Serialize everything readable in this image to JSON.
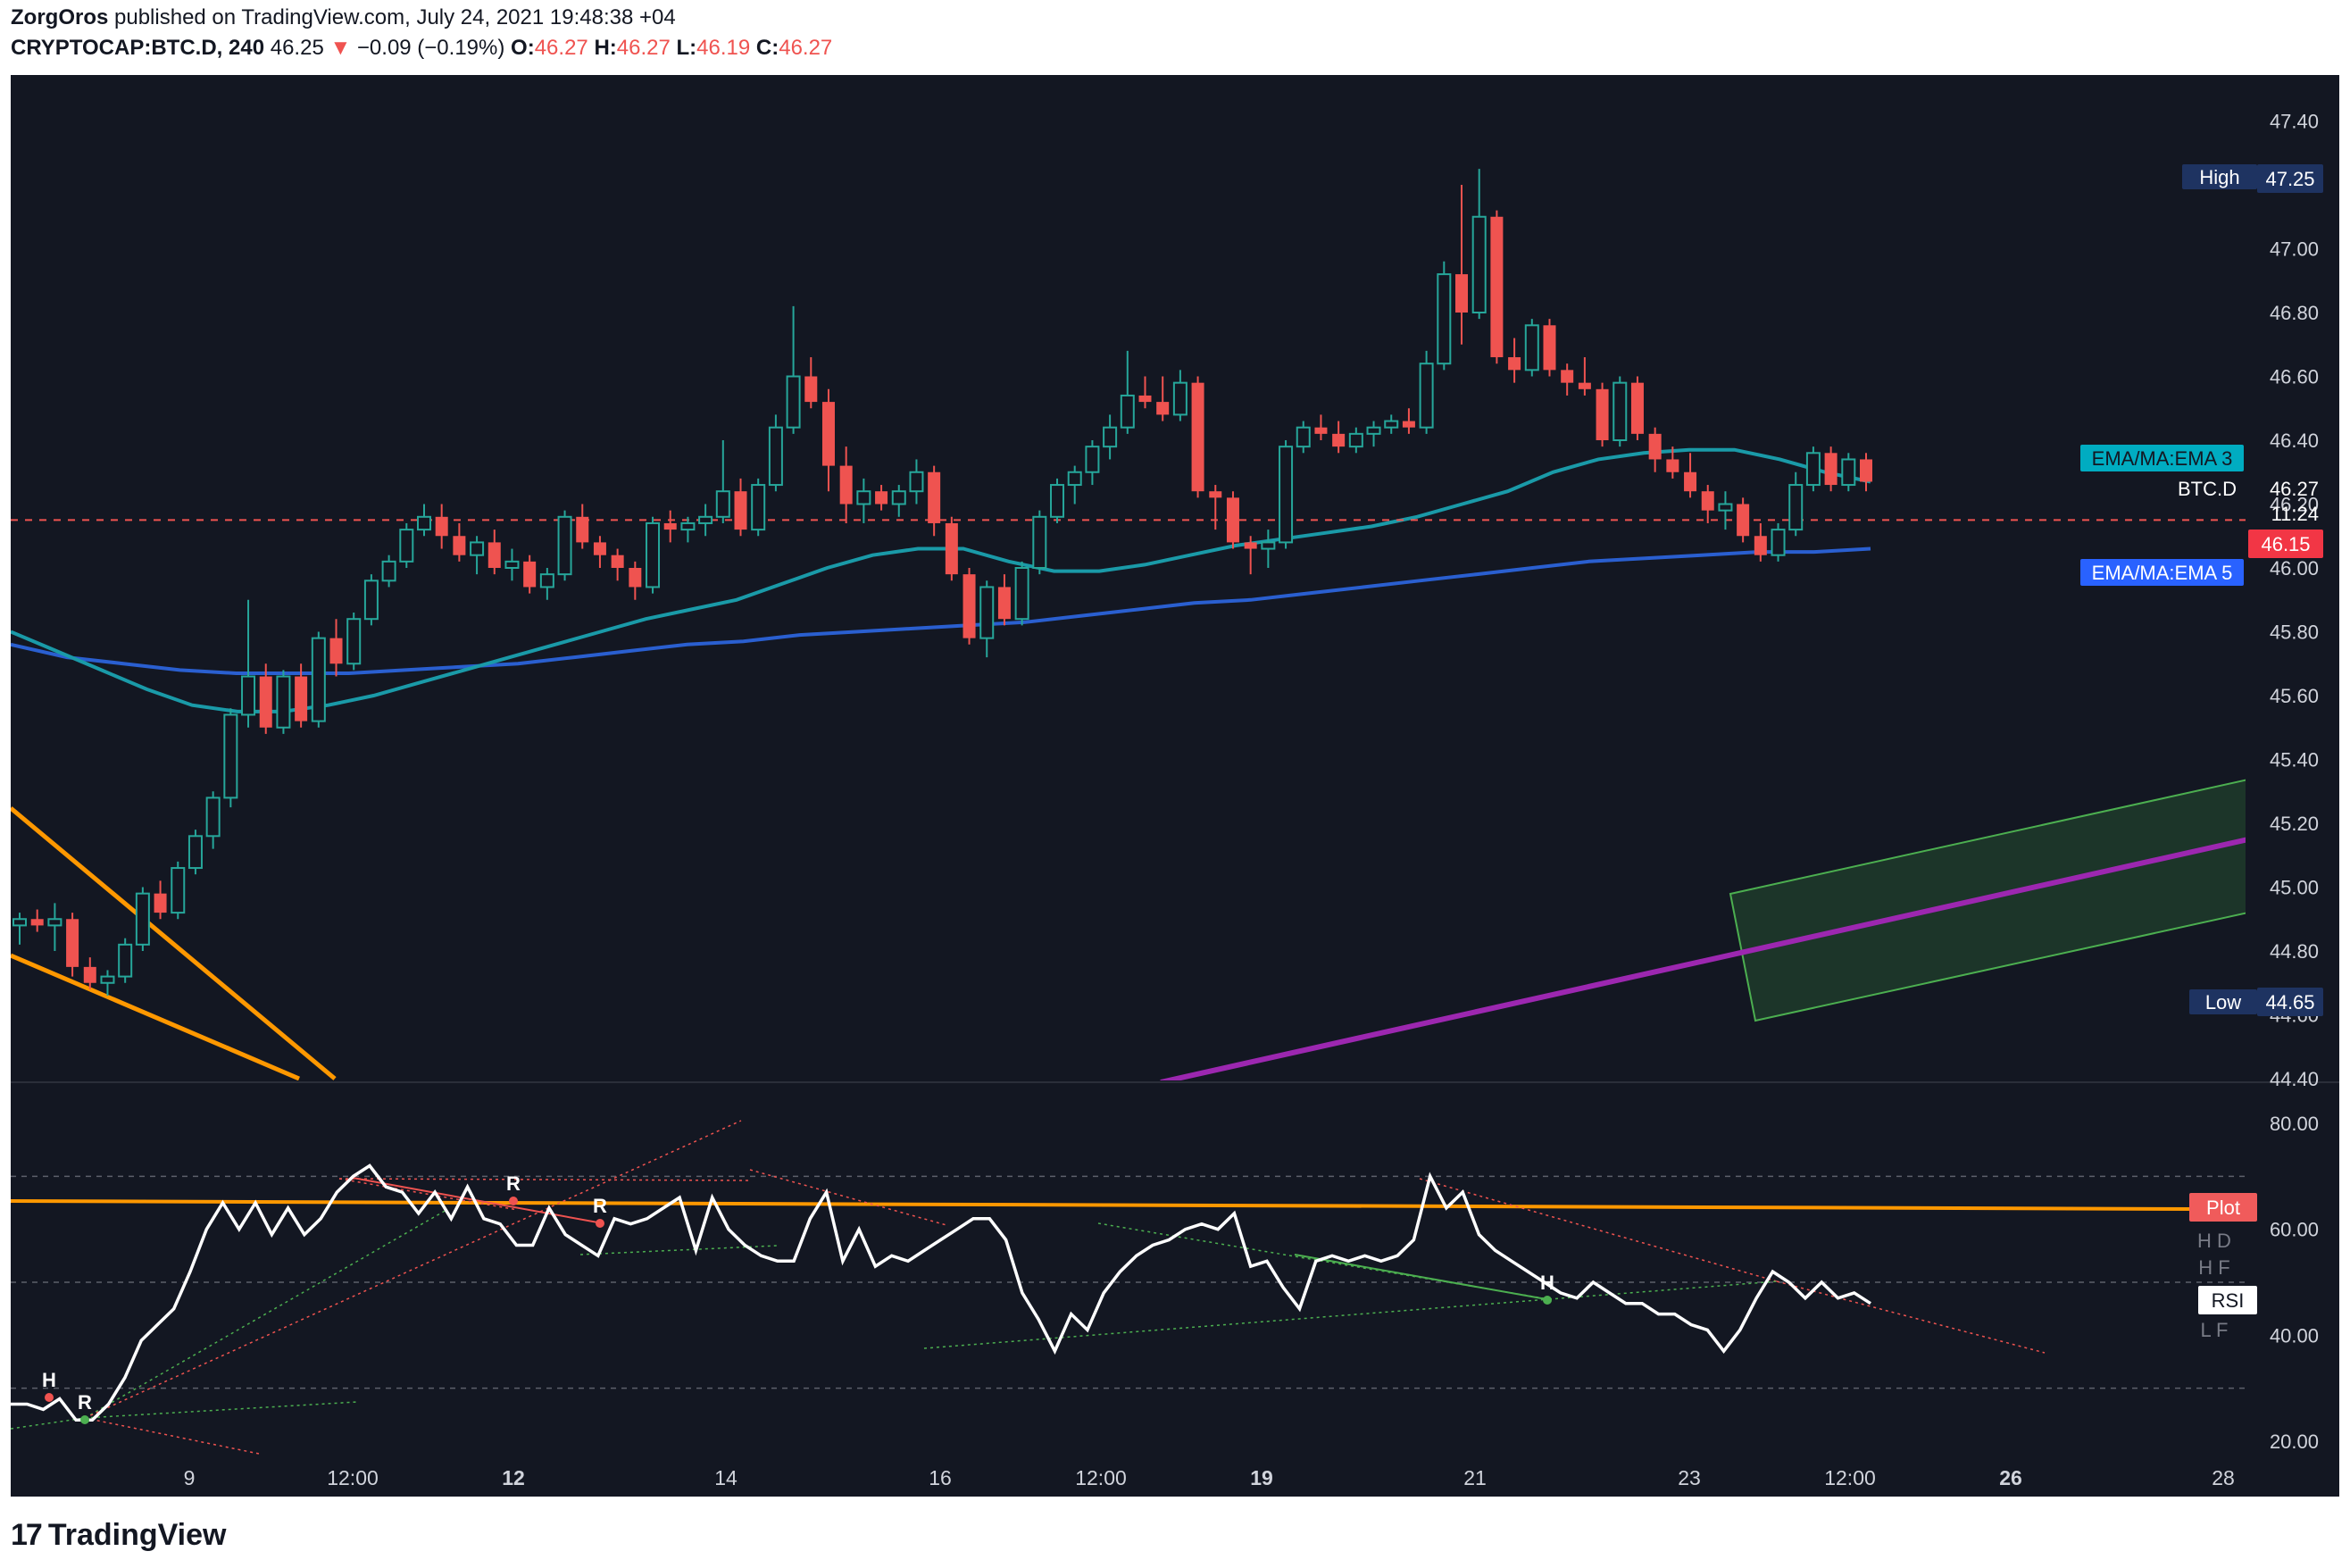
{
  "header": {
    "author": "ZorgOros",
    "published": "published on TradingView.com, July 24, 2021 19:48:38 +04",
    "symbol": "CRYPTOCAP:BTC.D, 240",
    "last": "46.25",
    "arrow": "▼",
    "change": "−0.09 (−0.19%)",
    "o_label": "O:",
    "o": "46.27",
    "h_label": "H:",
    "h": "46.27",
    "l_label": "L:",
    "l": "46.19",
    "c_label": "C:",
    "c": "46.27"
  },
  "footer": {
    "brand": "TradingView",
    "logo_icon": "tradingview-logo-icon"
  },
  "colors": {
    "background": "#131722",
    "up": "#26a69a",
    "down": "#ef5350",
    "ema3": "#1a9aa8",
    "ema5": "#2a5fd0",
    "wedge": "#ff9800",
    "channel_mid": "#9c27b0",
    "channel_fill": "#1e3b2a",
    "rsi": "#ffffff"
  },
  "price_axis": {
    "ticks": [
      "47.40",
      "47.20",
      "47.00",
      "46.80",
      "46.60",
      "46.40",
      "46.20",
      "46.00",
      "45.80",
      "45.60",
      "45.40",
      "45.20",
      "45.00",
      "44.80",
      "44.60",
      "44.40"
    ]
  },
  "rsi_axis": {
    "ticks": [
      "80.00",
      "60.00",
      "40.00",
      "20.00"
    ]
  },
  "time_axis": {
    "ticks": [
      {
        "label": "9",
        "bold": false
      },
      {
        "label": "12:00",
        "bold": false
      },
      {
        "label": "12",
        "bold": true
      },
      {
        "label": "14",
        "bold": false
      },
      {
        "label": "16",
        "bold": false
      },
      {
        "label": "12:00",
        "bold": false
      },
      {
        "label": "19",
        "bold": true
      },
      {
        "label": "21",
        "bold": false
      },
      {
        "label": "23",
        "bold": false
      },
      {
        "label": "12:00",
        "bold": false
      },
      {
        "label": "26",
        "bold": true
      },
      {
        "label": "28",
        "bold": false
      }
    ]
  },
  "labels": {
    "high": {
      "text": "High",
      "value": "47.25"
    },
    "low": {
      "text": "Low",
      "value": "44.65"
    },
    "ema3": "EMA/MA:EMA 3",
    "ema5": "EMA/MA:EMA 5",
    "btcd": {
      "text": "BTC.D",
      "value": "46.27"
    },
    "countdown": "11:24",
    "last_price": "46.15",
    "plot": "Plot",
    "rsi": "RSI",
    "hd": "H D",
    "hf": "H F",
    "lf": "L F",
    "pivots": [
      "H",
      "R",
      "R",
      "R",
      "H"
    ]
  },
  "chart_data": [
    {
      "type": "candlestick",
      "symbol": "CRYPTOCAP:BTC.D",
      "timeframe": "240",
      "ylim": [
        44.4,
        47.5
      ],
      "x_ticks": [
        "9",
        "12:00",
        "12",
        "14",
        "16",
        "12:00",
        "19",
        "21",
        "23",
        "12:00",
        "26",
        "28"
      ],
      "ohlc_approx": [
        [
          44.88,
          44.92,
          44.82,
          44.9
        ],
        [
          44.9,
          44.93,
          44.86,
          44.88
        ],
        [
          44.88,
          44.95,
          44.8,
          44.9
        ],
        [
          44.9,
          44.92,
          44.72,
          44.75
        ],
        [
          44.75,
          44.78,
          44.68,
          44.7
        ],
        [
          44.7,
          44.74,
          44.66,
          44.72
        ],
        [
          44.72,
          44.84,
          44.7,
          44.82
        ],
        [
          44.82,
          45.0,
          44.8,
          44.98
        ],
        [
          44.98,
          45.02,
          44.9,
          44.92
        ],
        [
          44.92,
          45.08,
          44.9,
          45.06
        ],
        [
          45.06,
          45.18,
          45.04,
          45.16
        ],
        [
          45.16,
          45.3,
          45.12,
          45.28
        ],
        [
          45.28,
          45.56,
          45.25,
          45.54
        ],
        [
          45.54,
          45.9,
          45.5,
          45.66
        ],
        [
          45.66,
          45.7,
          45.48,
          45.5
        ],
        [
          45.5,
          45.68,
          45.48,
          45.66
        ],
        [
          45.66,
          45.7,
          45.5,
          45.52
        ],
        [
          45.52,
          45.8,
          45.5,
          45.78
        ],
        [
          45.78,
          45.84,
          45.66,
          45.7
        ],
        [
          45.7,
          45.86,
          45.68,
          45.84
        ],
        [
          45.84,
          45.98,
          45.82,
          45.96
        ],
        [
          45.96,
          46.04,
          45.94,
          46.02
        ],
        [
          46.02,
          46.14,
          46.0,
          46.12
        ],
        [
          46.12,
          46.2,
          46.1,
          46.16
        ],
        [
          46.16,
          46.2,
          46.06,
          46.1
        ],
        [
          46.1,
          46.14,
          46.02,
          46.04
        ],
        [
          46.04,
          46.1,
          45.98,
          46.08
        ],
        [
          46.08,
          46.12,
          45.98,
          46.0
        ],
        [
          46.0,
          46.06,
          45.96,
          46.02
        ],
        [
          46.02,
          46.04,
          45.92,
          45.94
        ],
        [
          45.94,
          46.0,
          45.9,
          45.98
        ],
        [
          45.98,
          46.18,
          45.96,
          46.16
        ],
        [
          46.16,
          46.2,
          46.06,
          46.08
        ],
        [
          46.08,
          46.1,
          46.0,
          46.04
        ],
        [
          46.04,
          46.06,
          45.96,
          46.0
        ],
        [
          46.0,
          46.02,
          45.9,
          45.94
        ],
        [
          45.94,
          46.16,
          45.92,
          46.14
        ],
        [
          46.14,
          46.18,
          46.08,
          46.12
        ],
        [
          46.12,
          46.16,
          46.08,
          46.14
        ],
        [
          46.14,
          46.2,
          46.1,
          46.16
        ],
        [
          46.16,
          46.4,
          46.14,
          46.24
        ],
        [
          46.24,
          46.28,
          46.1,
          46.12
        ],
        [
          46.12,
          46.28,
          46.1,
          46.26
        ],
        [
          46.26,
          46.48,
          46.24,
          46.44
        ],
        [
          46.44,
          46.82,
          46.42,
          46.6
        ],
        [
          46.6,
          46.66,
          46.5,
          46.52
        ],
        [
          46.52,
          46.56,
          46.24,
          46.32
        ],
        [
          46.32,
          46.38,
          46.14,
          46.2
        ],
        [
          46.2,
          46.28,
          46.14,
          46.24
        ],
        [
          46.24,
          46.26,
          46.18,
          46.2
        ],
        [
          46.2,
          46.26,
          46.16,
          46.24
        ],
        [
          46.24,
          46.34,
          46.2,
          46.3
        ],
        [
          46.3,
          46.32,
          46.1,
          46.14
        ],
        [
          46.14,
          46.16,
          45.96,
          45.98
        ],
        [
          45.98,
          46.0,
          45.76,
          45.78
        ],
        [
          45.78,
          45.96,
          45.72,
          45.94
        ],
        [
          45.94,
          45.98,
          45.82,
          45.84
        ],
        [
          45.84,
          46.02,
          45.82,
          46.0
        ],
        [
          46.0,
          46.18,
          45.98,
          46.16
        ],
        [
          46.16,
          46.28,
          46.14,
          46.26
        ],
        [
          46.26,
          46.32,
          46.2,
          46.3
        ],
        [
          46.3,
          46.4,
          46.26,
          46.38
        ],
        [
          46.38,
          46.48,
          46.34,
          46.44
        ],
        [
          46.44,
          46.68,
          46.42,
          46.54
        ],
        [
          46.54,
          46.6,
          46.5,
          46.52
        ],
        [
          46.52,
          46.6,
          46.46,
          46.48
        ],
        [
          46.48,
          46.62,
          46.46,
          46.58
        ],
        [
          46.58,
          46.6,
          46.22,
          46.24
        ],
        [
          46.24,
          46.26,
          46.12,
          46.22
        ],
        [
          46.22,
          46.24,
          46.06,
          46.08
        ],
        [
          46.08,
          46.1,
          45.98,
          46.06
        ],
        [
          46.06,
          46.12,
          46.0,
          46.08
        ],
        [
          46.08,
          46.4,
          46.06,
          46.38
        ],
        [
          46.38,
          46.46,
          46.36,
          46.44
        ],
        [
          46.44,
          46.48,
          46.4,
          46.42
        ],
        [
          46.42,
          46.46,
          46.36,
          46.38
        ],
        [
          46.38,
          46.44,
          46.36,
          46.42
        ],
        [
          46.42,
          46.46,
          46.38,
          46.44
        ],
        [
          46.44,
          46.48,
          46.42,
          46.46
        ],
        [
          46.46,
          46.5,
          46.42,
          46.44
        ],
        [
          46.44,
          46.68,
          46.42,
          46.64
        ],
        [
          46.64,
          46.96,
          46.62,
          46.92
        ],
        [
          46.92,
          47.2,
          46.7,
          46.8
        ],
        [
          46.8,
          47.25,
          46.78,
          47.1
        ],
        [
          47.1,
          47.12,
          46.64,
          46.66
        ],
        [
          46.66,
          46.72,
          46.58,
          46.62
        ],
        [
          46.62,
          46.78,
          46.6,
          46.76
        ],
        [
          46.76,
          46.78,
          46.6,
          46.62
        ],
        [
          46.62,
          46.64,
          46.54,
          46.58
        ],
        [
          46.58,
          46.66,
          46.54,
          46.56
        ],
        [
          46.56,
          46.58,
          46.38,
          46.4
        ],
        [
          46.4,
          46.6,
          46.38,
          46.58
        ],
        [
          46.58,
          46.6,
          46.4,
          46.42
        ],
        [
          46.42,
          46.44,
          46.3,
          46.34
        ],
        [
          46.34,
          46.38,
          46.28,
          46.3
        ],
        [
          46.3,
          46.36,
          46.22,
          46.24
        ],
        [
          46.24,
          46.26,
          46.14,
          46.18
        ],
        [
          46.18,
          46.24,
          46.12,
          46.2
        ],
        [
          46.2,
          46.22,
          46.08,
          46.1
        ],
        [
          46.1,
          46.14,
          46.02,
          46.04
        ],
        [
          46.04,
          46.14,
          46.02,
          46.12
        ],
        [
          46.12,
          46.3,
          46.1,
          46.26
        ],
        [
          46.26,
          46.38,
          46.24,
          46.36
        ],
        [
          46.36,
          46.38,
          46.24,
          46.26
        ],
        [
          46.26,
          46.36,
          46.24,
          46.34
        ],
        [
          46.34,
          46.36,
          46.24,
          46.27
        ]
      ],
      "ema3_approx": [
        45.8,
        45.74,
        45.68,
        45.62,
        45.57,
        45.55,
        45.55,
        45.57,
        45.6,
        45.64,
        45.68,
        45.72,
        45.76,
        45.8,
        45.84,
        45.87,
        45.9,
        45.95,
        46.0,
        46.04,
        46.06,
        46.06,
        46.02,
        45.99,
        45.99,
        46.01,
        46.04,
        46.07,
        46.09,
        46.11,
        46.13,
        46.16,
        46.2,
        46.24,
        46.3,
        46.34,
        46.36,
        46.37,
        46.37,
        46.34,
        46.3,
        46.27
      ],
      "ema5_approx": [
        45.76,
        45.72,
        45.7,
        45.68,
        45.67,
        45.67,
        45.67,
        45.68,
        45.69,
        45.7,
        45.72,
        45.74,
        45.76,
        45.77,
        45.79,
        45.8,
        45.81,
        45.82,
        45.83,
        45.85,
        45.87,
        45.89,
        45.9,
        45.92,
        45.94,
        45.96,
        45.98,
        46.0,
        46.02,
        46.03,
        46.04,
        46.05,
        46.05,
        46.06
      ]
    },
    {
      "type": "line",
      "name": "RSI",
      "ylim": [
        15,
        85
      ],
      "levels": [
        70,
        50,
        30
      ],
      "values": [
        27,
        27,
        26,
        28,
        24,
        24,
        27,
        32,
        39,
        42,
        45,
        52,
        60,
        65,
        60,
        65,
        59,
        64,
        59,
        62,
        67,
        70,
        72,
        68,
        67,
        63,
        67,
        62,
        68,
        62,
        61,
        57,
        57,
        64,
        59,
        57,
        55,
        62,
        61,
        62,
        64,
        66,
        56,
        66,
        60,
        57,
        55,
        54,
        54,
        62,
        67,
        54,
        60,
        53,
        55,
        54,
        56,
        58,
        60,
        62,
        62,
        58,
        48,
        43,
        37,
        44,
        41,
        48,
        52,
        55,
        57,
        58,
        60,
        61,
        60,
        63,
        53,
        54,
        49,
        45,
        54,
        55,
        54,
        55,
        54,
        55,
        58,
        70,
        64,
        67,
        59,
        56,
        54,
        52,
        50,
        48,
        47,
        50,
        48,
        46,
        46,
        44,
        44,
        42,
        41,
        37,
        41,
        47,
        52,
        50,
        47,
        50,
        47,
        48,
        46
      ]
    }
  ]
}
